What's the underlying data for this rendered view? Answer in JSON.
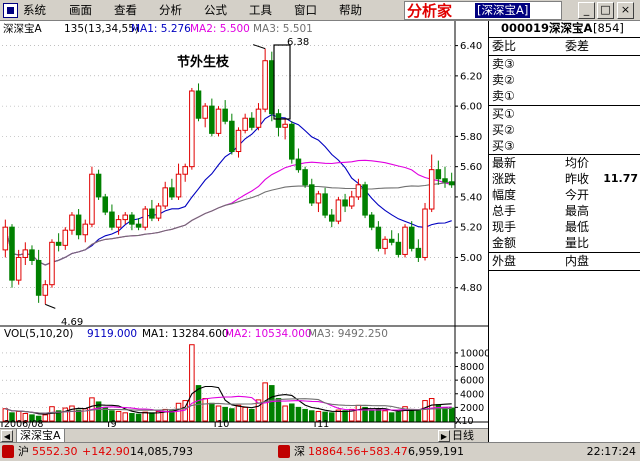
{
  "menu": {
    "items": [
      "系统",
      "画面",
      "查看",
      "分析",
      "公式",
      "工具",
      "窗口",
      "帮助"
    ],
    "brand": "分析家",
    "brand_stock": "[深深宝A]",
    "window_buttons": [
      "_",
      "□",
      "×"
    ]
  },
  "chart_data": {
    "type": "candlestick",
    "title": "深深宝A",
    "legend": {
      "kline": "135(13,34,55)",
      "ma1_label": "MA1: 5.276",
      "ma2_label": "MA2: 5.500",
      "ma3_label": "MA3: 5.501"
    },
    "vol_legend": {
      "title": "VOL(5,10,20)",
      "vol": "9119.000",
      "ma1": "MA1: 13284.600",
      "ma2": "MA2: 10534.000",
      "ma3": "MA3: 9492.250"
    },
    "annotation": "节外生枝",
    "high_marker": "6.38",
    "low_marker": "4.69",
    "price_axis": [
      6.4,
      6.2,
      6.0,
      5.8,
      5.6,
      5.4,
      5.2,
      5.0,
      4.8
    ],
    "price_ylim": [
      4.58,
      6.47
    ],
    "vol_axis": [
      10000,
      8000,
      6000,
      4000,
      2000
    ],
    "vol_axis_unit": "X10",
    "vol_ylim": [
      0,
      11600
    ],
    "x_labels": [
      {
        "label": "2006/08",
        "index": 0
      },
      {
        "label": "9",
        "index": 16
      },
      {
        "label": "10",
        "index": 32
      },
      {
        "label": "11",
        "index": 47
      }
    ],
    "candles": [
      [
        5.05,
        5.25,
        5.0,
        5.2
      ],
      [
        5.2,
        5.22,
        4.8,
        4.85
      ],
      [
        4.85,
        5.05,
        4.82,
        5.0
      ],
      [
        5.0,
        5.1,
        4.95,
        5.05
      ],
      [
        5.05,
        5.08,
        4.95,
        4.98
      ],
      [
        4.98,
        5.05,
        4.7,
        4.75
      ],
      [
        4.75,
        4.85,
        4.69,
        4.82
      ],
      [
        4.82,
        5.12,
        4.8,
        5.1
      ],
      [
        5.1,
        5.16,
        5.04,
        5.08
      ],
      [
        5.08,
        5.2,
        5.05,
        5.18
      ],
      [
        5.18,
        5.3,
        5.15,
        5.28
      ],
      [
        5.28,
        5.32,
        5.12,
        5.15
      ],
      [
        5.15,
        5.25,
        5.1,
        5.22
      ],
      [
        5.22,
        5.6,
        5.2,
        5.55
      ],
      [
        5.55,
        5.58,
        5.38,
        5.4
      ],
      [
        5.4,
        5.42,
        5.28,
        5.3
      ],
      [
        5.3,
        5.35,
        5.18,
        5.2
      ],
      [
        5.2,
        5.28,
        5.15,
        5.25
      ],
      [
        5.25,
        5.3,
        5.22,
        5.28
      ],
      [
        5.28,
        5.3,
        5.18,
        5.22
      ],
      [
        5.22,
        5.26,
        5.18,
        5.2
      ],
      [
        5.2,
        5.34,
        5.18,
        5.32
      ],
      [
        5.32,
        5.38,
        5.24,
        5.26
      ],
      [
        5.26,
        5.36,
        5.24,
        5.34
      ],
      [
        5.34,
        5.5,
        5.32,
        5.46
      ],
      [
        5.46,
        5.52,
        5.38,
        5.4
      ],
      [
        5.4,
        5.62,
        5.38,
        5.55
      ],
      [
        5.55,
        5.62,
        5.5,
        5.6
      ],
      [
        5.6,
        6.12,
        5.58,
        6.1
      ],
      [
        6.1,
        6.15,
        5.9,
        5.92
      ],
      [
        5.92,
        6.02,
        5.86,
        6.0
      ],
      [
        6.0,
        6.05,
        5.8,
        5.82
      ],
      [
        5.82,
        6.0,
        5.8,
        5.98
      ],
      [
        5.98,
        6.04,
        5.88,
        5.9
      ],
      [
        5.9,
        5.95,
        5.68,
        5.7
      ],
      [
        5.7,
        5.86,
        5.66,
        5.84
      ],
      [
        5.84,
        5.95,
        5.82,
        5.92
      ],
      [
        5.92,
        5.96,
        5.84,
        5.86
      ],
      [
        5.86,
        6.02,
        5.84,
        5.98
      ],
      [
        5.98,
        6.38,
        5.96,
        6.3
      ],
      [
        6.3,
        6.36,
        5.9,
        5.95
      ],
      [
        5.95,
        5.98,
        5.8,
        5.86
      ],
      [
        5.86,
        5.92,
        5.78,
        5.88
      ],
      [
        5.88,
        5.9,
        5.62,
        5.65
      ],
      [
        5.65,
        5.72,
        5.56,
        5.58
      ],
      [
        5.58,
        5.6,
        5.46,
        5.48
      ],
      [
        5.48,
        5.52,
        5.34,
        5.36
      ],
      [
        5.36,
        5.44,
        5.3,
        5.42
      ],
      [
        5.42,
        5.46,
        5.26,
        5.28
      ],
      [
        5.28,
        5.32,
        5.2,
        5.24
      ],
      [
        5.24,
        5.4,
        5.22,
        5.38
      ],
      [
        5.38,
        5.42,
        5.3,
        5.34
      ],
      [
        5.34,
        5.44,
        5.32,
        5.4
      ],
      [
        5.4,
        5.52,
        5.38,
        5.48
      ],
      [
        5.48,
        5.5,
        5.26,
        5.28
      ],
      [
        5.28,
        5.3,
        5.18,
        5.2
      ],
      [
        5.2,
        5.24,
        5.04,
        5.06
      ],
      [
        5.06,
        5.14,
        5.02,
        5.12
      ],
      [
        5.12,
        5.18,
        5.08,
        5.1
      ],
      [
        5.1,
        5.16,
        5.0,
        5.02
      ],
      [
        5.02,
        5.22,
        5.0,
        5.2
      ],
      [
        5.2,
        5.24,
        5.04,
        5.06
      ],
      [
        5.06,
        5.12,
        4.97,
        5.0
      ],
      [
        5.0,
        5.36,
        4.98,
        5.32
      ],
      [
        5.32,
        5.68,
        5.3,
        5.58
      ],
      [
        5.58,
        5.64,
        5.48,
        5.52
      ],
      [
        5.52,
        5.6,
        5.46,
        5.5
      ],
      [
        5.5,
        5.56,
        5.46,
        5.48
      ]
    ],
    "volumes": [
      1800,
      1200,
      1400,
      1100,
      900,
      700,
      900,
      2100,
      1500,
      1900,
      2200,
      1600,
      1800,
      3400,
      2800,
      2000,
      1500,
      1400,
      1200,
      1100,
      1000,
      1300,
      1200,
      1400,
      1700,
      1500,
      2600,
      3000,
      11200,
      5200,
      3300,
      2600,
      2200,
      2000,
      1800,
      2300,
      2000,
      1700,
      3100,
      5600,
      5200,
      3300,
      2200,
      2500,
      2000,
      1700,
      1500,
      1400,
      1300,
      1200,
      1600,
      1500,
      1700,
      2300,
      2000,
      1500,
      1700,
      1500,
      1200,
      1300,
      2100,
      1700,
      1600,
      3000,
      3300,
      2400,
      2000,
      1900
    ]
  },
  "quote": {
    "code": "000019",
    "name": "深深宝A",
    "num": "[854]",
    "wei_bi": "委比",
    "wei_cha": "委差",
    "sell": [
      "卖③",
      "卖②",
      "卖①"
    ],
    "buy": [
      "买①",
      "买②",
      "买③"
    ],
    "rows": [
      [
        "最新",
        "均价",
        ""
      ],
      [
        "涨跌",
        "昨收",
        "11.77"
      ],
      [
        "幅度",
        "今开",
        ""
      ],
      [
        "总手",
        "最高",
        ""
      ],
      [
        "现手",
        "最低",
        ""
      ],
      [
        "金额",
        "量比",
        ""
      ]
    ],
    "outer": "外盘",
    "inner": "内盘"
  },
  "tabs": {
    "stock_tab": "深深宝A",
    "period": "日线"
  },
  "status": {
    "sh_label": "沪",
    "sh_index": "5552.30",
    "sh_change": "+142.90",
    "sh_volume": "14,085,793",
    "sz_label": "深",
    "sz_index": "18864.56",
    "sz_change": "+583.47",
    "sz_volume": "6,959,191",
    "time": "22:17:24"
  }
}
